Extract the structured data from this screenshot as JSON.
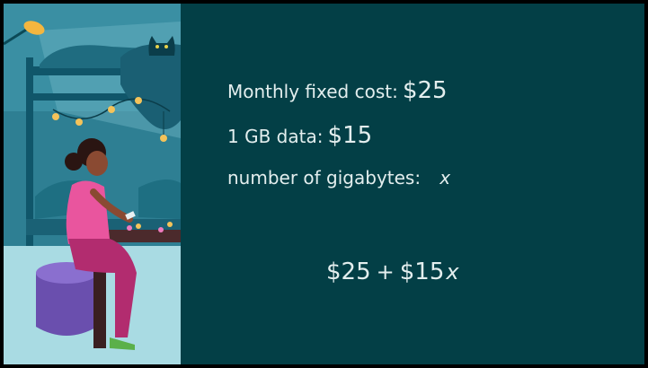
{
  "slide": {
    "fixed_cost_label": "Monthly fixed cost:",
    "fixed_cost_value": "$25",
    "data_label": "1 GB data:",
    "data_value": "$15",
    "gigabytes_label": "number of gigabytes:",
    "gigabytes_var": "x",
    "expression": {
      "term1": "$25",
      "operator": "+",
      "term2": "$15",
      "variable": "x"
    }
  },
  "colors": {
    "panel_background": "#033f46",
    "text": "#e3eeee",
    "illustration_wall": "#2e7f93",
    "floor": "#a9dbe3"
  }
}
